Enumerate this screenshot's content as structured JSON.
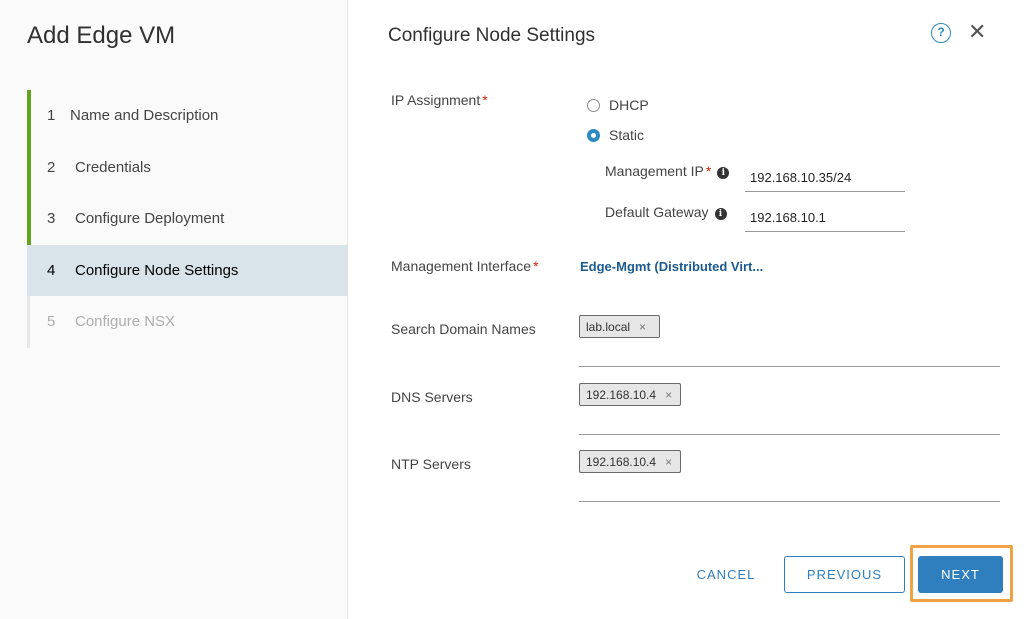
{
  "sidebar": {
    "title": "Add Edge VM",
    "steps": [
      {
        "num": "1",
        "label": "Name and Description"
      },
      {
        "num": "2",
        "label": "Credentials"
      },
      {
        "num": "3",
        "label": "Configure Deployment"
      },
      {
        "num": "4",
        "label": "Configure Node Settings"
      },
      {
        "num": "5",
        "label": "Configure NSX"
      }
    ]
  },
  "main": {
    "title": "Configure Node Settings",
    "help_icon": "?",
    "close_icon": "✕",
    "ip_assignment": {
      "label": "IP Assignment",
      "required": "*",
      "options": [
        {
          "label": "DHCP",
          "selected": false
        },
        {
          "label": "Static",
          "selected": true
        }
      ]
    },
    "management_ip": {
      "label": "Management IP",
      "required": "*",
      "value": "192.168.10.35/24"
    },
    "default_gateway": {
      "label": "Default Gateway",
      "value": "192.168.10.1"
    },
    "management_interface": {
      "label": "Management Interface",
      "required": "*",
      "value": "Edge-Mgmt (Distributed Virt..."
    },
    "search_domains": {
      "label": "Search Domain Names",
      "tags": [
        "lab.local"
      ]
    },
    "dns_servers": {
      "label": "DNS Servers",
      "tags": [
        "192.168.10.4"
      ]
    },
    "ntp_servers": {
      "label": "NTP Servers",
      "tags": [
        "192.168.10.4"
      ]
    },
    "tag_remove": "×",
    "info_glyph": "i"
  },
  "footer": {
    "cancel": "CANCEL",
    "previous": "PREVIOUS",
    "next": "NEXT"
  },
  "colors": {
    "accent": "#2f7fbf",
    "done_step": "#62a420",
    "highlight": "#f0a244",
    "required": "#c92100"
  }
}
